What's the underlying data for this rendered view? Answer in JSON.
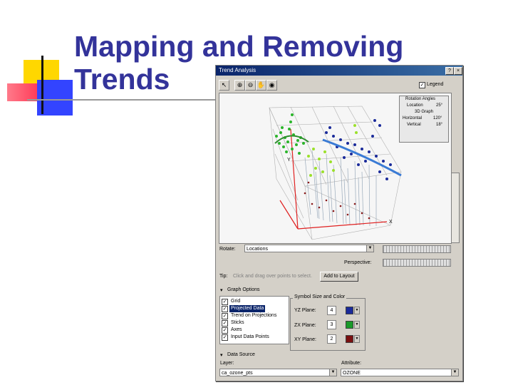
{
  "slide": {
    "title_line1": "Mapping and Removing",
    "title_line2": "Trends"
  },
  "dialog": {
    "title": "Trend Analysis",
    "help_glyph": "?",
    "close_glyph": "×",
    "legend_label": "Legend",
    "legend_checked": true,
    "rotation": {
      "heading": "Rotation Angles",
      "location_label": "Location",
      "location_value": "25°",
      "graph_label": "3D Graph",
      "horizontal_label": "Horizontal",
      "horizontal_value": "120°",
      "vertical_label": "Vertical",
      "vertical_value": "18°"
    },
    "axis_labels": {
      "y": "Y",
      "x": "X"
    },
    "rotate_label": "Rotate:",
    "rotate_value": "Locations",
    "perspective_label": "Perspective:",
    "tip_label": "Tip:",
    "tip_text": "Click and drag over points to select.",
    "add_to_layout": "Add to Layout",
    "graph_options_label": "Graph Options",
    "graph_options": [
      {
        "label": "Grid",
        "checked": true,
        "selected": false
      },
      {
        "label": "Projected Data",
        "checked": true,
        "selected": true
      },
      {
        "label": "Trend on Projections",
        "checked": true,
        "selected": false
      },
      {
        "label": "Sticks",
        "checked": true,
        "selected": false
      },
      {
        "label": "Axes",
        "checked": true,
        "selected": false
      },
      {
        "label": "Input Data Points",
        "checked": true,
        "selected": false
      }
    ],
    "symbol_group_label": "Symbol Size and Color",
    "planes": [
      {
        "label": "YZ Plane:",
        "size": "4",
        "color": "#1a2a9a"
      },
      {
        "label": "ZX Plane:",
        "size": "3",
        "color": "#1a9a2a"
      },
      {
        "label": "XY Plane:",
        "size": "2",
        "color": "#7a1010"
      }
    ],
    "data_source_label": "Data Source",
    "layer_label": "Layer:",
    "layer_value": "ca_ozone_pts",
    "attribute_label": "Attribute:",
    "attribute_value": "OZONE"
  }
}
